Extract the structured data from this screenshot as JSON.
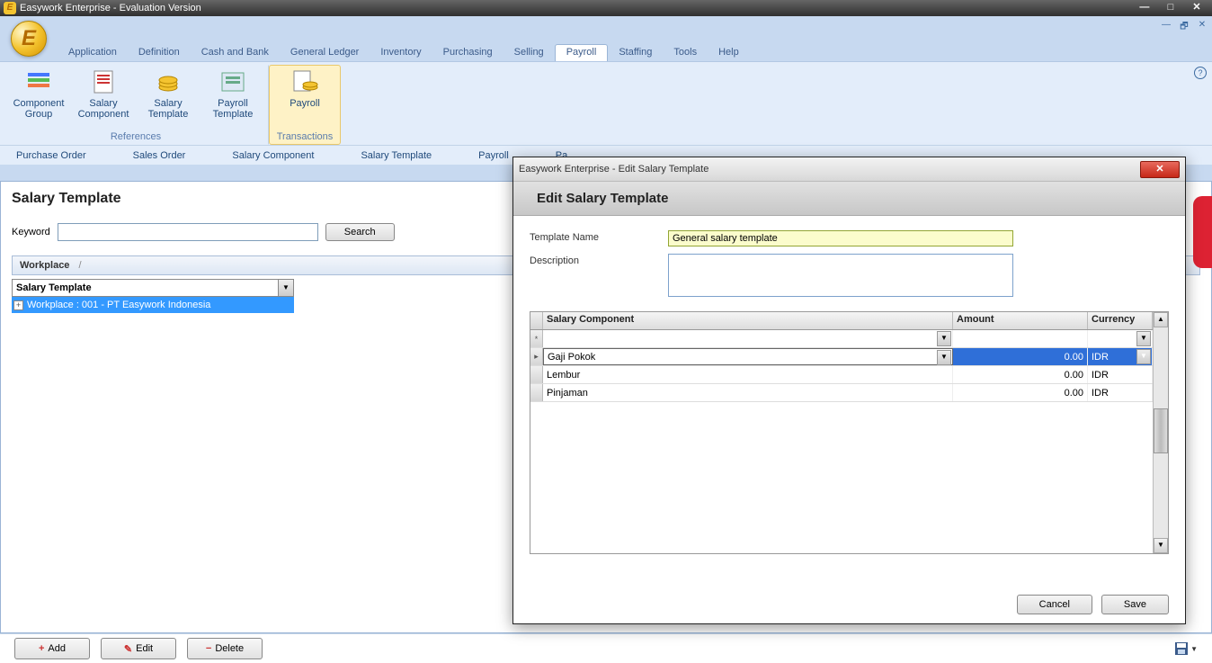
{
  "titlebar": {
    "title": "Easywork Enterprise - Evaluation Version"
  },
  "menutabs": [
    "Application",
    "Definition",
    "Cash and Bank",
    "General Ledger",
    "Inventory",
    "Purchasing",
    "Selling",
    "Payroll",
    "Staffing",
    "Tools",
    "Help"
  ],
  "menutabs_active": "Payroll",
  "ribbon": {
    "groups": [
      {
        "label": "References",
        "active": false,
        "buttons": [
          {
            "label": "Component Group"
          },
          {
            "label": "Salary Component"
          },
          {
            "label": "Salary Template"
          },
          {
            "label": "Payroll Template"
          }
        ]
      },
      {
        "label": "Transactions",
        "active": true,
        "buttons": [
          {
            "label": "Payroll"
          }
        ]
      }
    ]
  },
  "wstabs": [
    "Purchase Order",
    "Sales Order",
    "Salary Component",
    "Salary Template",
    "Payroll",
    "Pa"
  ],
  "page": {
    "title": "Salary Template",
    "keyword_label": "Keyword",
    "search_btn": "Search",
    "breadcrumb": [
      "Workplace",
      "/"
    ],
    "tree_select": "Salary Template",
    "tree_row": "Workplace : 001 - PT Easywork Indonesia"
  },
  "bottom": {
    "add": "Add",
    "edit": "Edit",
    "delete": "Delete"
  },
  "dialog": {
    "title": "Easywork Enterprise - Edit Salary Template",
    "heading": "Edit Salary Template",
    "fields": {
      "template_name_label": "Template Name",
      "template_name_value": "General salary template",
      "description_label": "Description",
      "description_value": ""
    },
    "grid": {
      "headers": {
        "component": "Salary Component",
        "amount": "Amount",
        "currency": "Currency"
      },
      "rows": [
        {
          "component": "Gaji Pokok",
          "amount": "0.00",
          "currency": "IDR",
          "selected": true
        },
        {
          "component": "Lembur",
          "amount": "0.00",
          "currency": "IDR",
          "selected": false
        },
        {
          "component": "Pinjaman",
          "amount": "0.00",
          "currency": "IDR",
          "selected": false
        }
      ]
    },
    "buttons": {
      "cancel": "Cancel",
      "save": "Save"
    }
  }
}
